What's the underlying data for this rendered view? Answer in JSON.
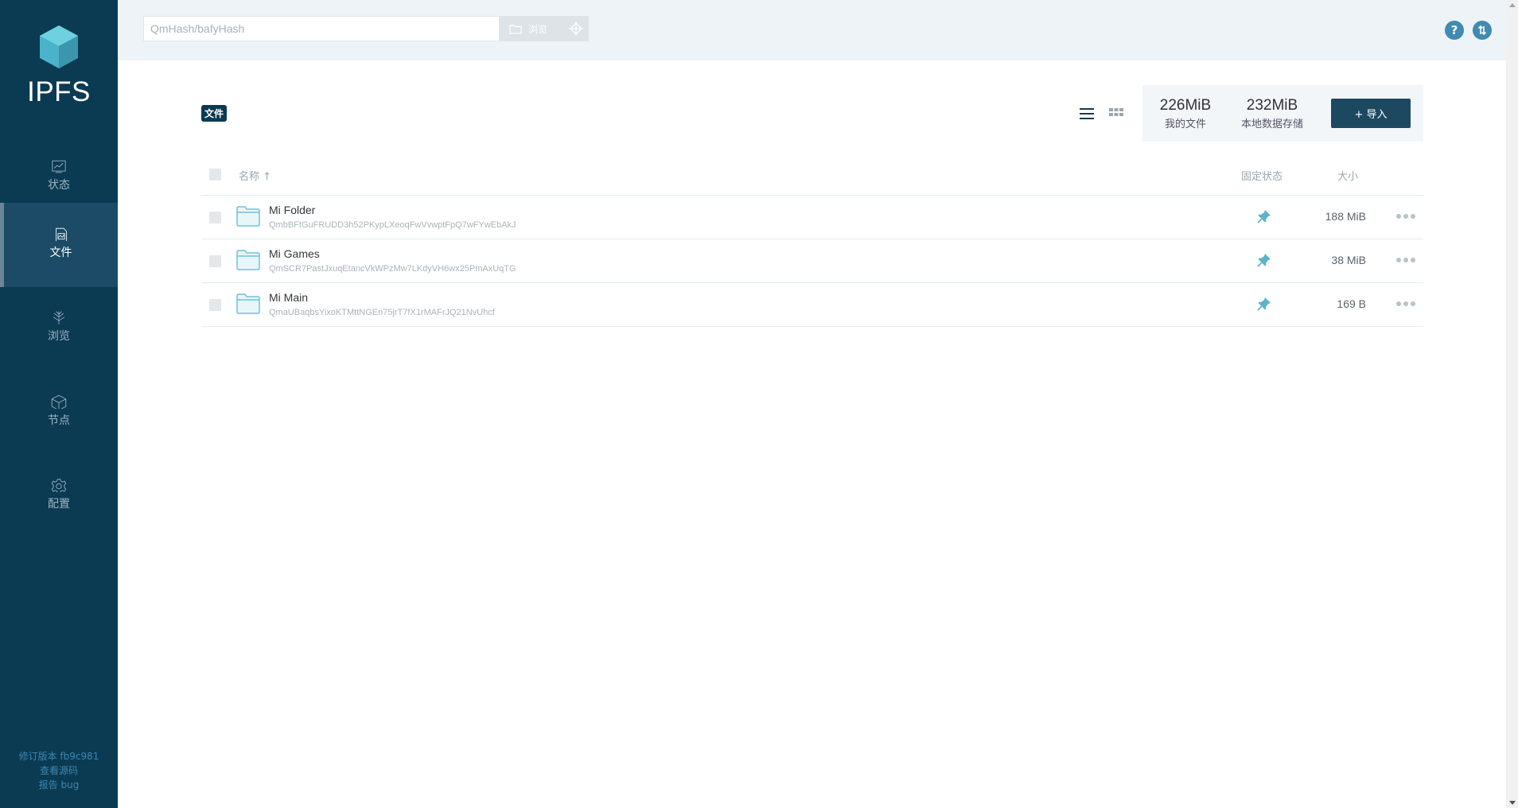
{
  "app": {
    "logo_text": "IPFS"
  },
  "sidebar": {
    "items": [
      {
        "label": "状态",
        "icon": "status-chart-icon"
      },
      {
        "label": "文件",
        "icon": "files-icon",
        "active": true
      },
      {
        "label": "浏览",
        "icon": "explore-tree-icon"
      },
      {
        "label": "节点",
        "icon": "peers-cube-icon"
      },
      {
        "label": "配置",
        "icon": "settings-gear-icon"
      }
    ],
    "footer": {
      "revision": "修订版本 fb9c981",
      "source": "查看源码",
      "report": "报告 bug"
    }
  },
  "header": {
    "search_placeholder": "QmHash/bafyHash",
    "browse_label": "浏览"
  },
  "files": {
    "breadcrumb": "文件",
    "stats": {
      "my_files_value": "226MiB",
      "my_files_label": "我的文件",
      "repo_value": "232MiB",
      "repo_label": "本地数据存储"
    },
    "import_label": "+ 导入",
    "columns": {
      "name": "名称 ↑",
      "pin": "固定状态",
      "size": "大小"
    },
    "rows": [
      {
        "name": "Mi Folder",
        "hash": "QmbBFtGuFRUDD3h52PKypLXeoqFwVvwptFpQ7wFYwEbAkJ",
        "size": "188 MiB",
        "pinned": true
      },
      {
        "name": "Mi Games",
        "hash": "QmSCR7PastJxuqEtancVkWPzMw7LKdyVH6wx25PmAxUqTG",
        "size": "38 MiB",
        "pinned": true
      },
      {
        "name": "Mi Main",
        "hash": "QmaUBaqbsYixoKTMttNGEn75jrT7fX1rMAFrJQ21NvUhcf",
        "size": "169 B",
        "pinned": true
      }
    ]
  },
  "colors": {
    "sidebar_bg": "#0b3a53",
    "accent": "#418ab2",
    "folder": "#6fc4d8"
  }
}
